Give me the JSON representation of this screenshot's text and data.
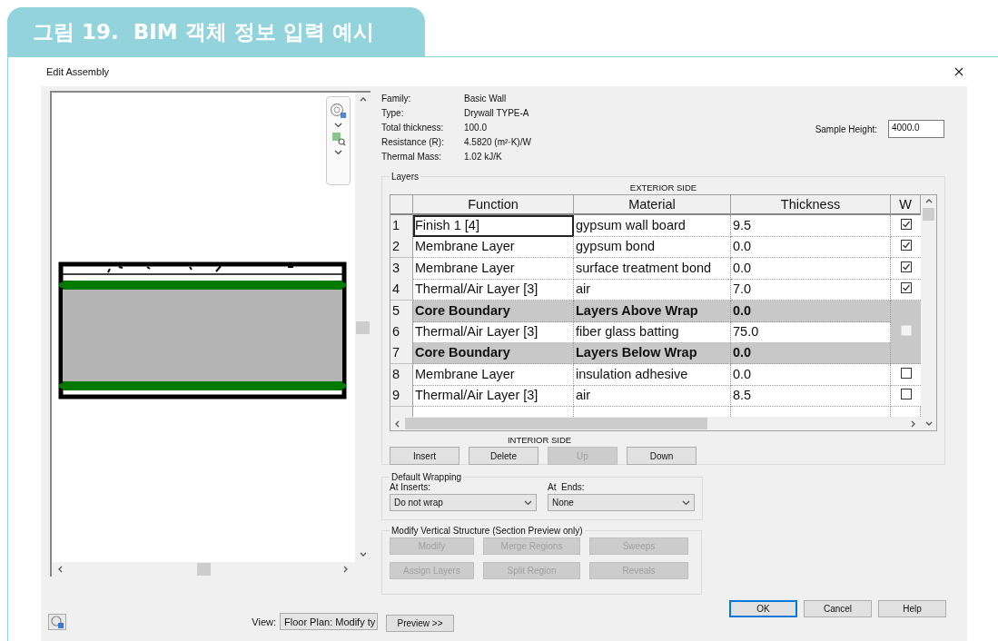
{
  "header": {
    "title": "그림 19.  BIM 객체 정보 입력 예시"
  },
  "dialog": {
    "title": "Edit Assembly"
  },
  "properties": [
    {
      "label": "Family:",
      "value": "Basic Wall"
    },
    {
      "label": "Type:",
      "value": "Drywall TYPE-A"
    },
    {
      "label": "Total thickness:",
      "value": "100.0"
    },
    {
      "label": "Resistance (R):",
      "value": "4.5820 (m²·K)/W"
    },
    {
      "label": "Thermal Mass:",
      "value": "1.02 kJ/K"
    }
  ],
  "sample_height": {
    "label": "Sample Height:",
    "value": "4000.0"
  },
  "layers": {
    "title": "Layers",
    "top_caption": "EXTERIOR SIDE",
    "bottom_caption": "INTERIOR SIDE",
    "columns": [
      "Function",
      "Material",
      "Thickness",
      "W"
    ],
    "rows": [
      {
        "num": "1",
        "kind": "layer",
        "function": "Finish 1 [4]",
        "material": "gypsum wall board",
        "thickness": "9.5",
        "wraps": true,
        "disabled": false,
        "selected": true
      },
      {
        "num": "2",
        "kind": "layer",
        "function": "Membrane Layer",
        "material": "gypsum bond",
        "thickness": "0.0",
        "wraps": true,
        "disabled": false,
        "selected": false
      },
      {
        "num": "3",
        "kind": "layer",
        "function": "Membrane Layer",
        "material": "surface treatment bond",
        "thickness": "0.0",
        "wraps": true,
        "disabled": false,
        "selected": false
      },
      {
        "num": "4",
        "kind": "layer",
        "function": "Thermal/Air Layer [3]",
        "material": "air",
        "thickness": "7.0",
        "wraps": true,
        "disabled": false,
        "selected": false
      },
      {
        "num": "5",
        "kind": "boundary",
        "function": "Core Boundary",
        "material": "Layers Above Wrap",
        "thickness": "0.0",
        "selected": false
      },
      {
        "num": "6",
        "kind": "layer",
        "function": "Thermal/Air Layer [3]",
        "material": "fiber glass batting",
        "thickness": "75.0",
        "wraps": false,
        "disabled": true,
        "selected": false
      },
      {
        "num": "7",
        "kind": "boundary",
        "function": "Core Boundary",
        "material": "Layers Below Wrap",
        "thickness": "0.0",
        "selected": false
      },
      {
        "num": "8",
        "kind": "layer",
        "function": "Membrane Layer",
        "material": "insulation adhesive",
        "thickness": "0.0",
        "wraps": false,
        "disabled": false,
        "selected": false
      },
      {
        "num": "9",
        "kind": "layer",
        "function": "Thermal/Air Layer [3]",
        "material": "air",
        "thickness": "8.5",
        "wraps": false,
        "disabled": false,
        "selected": false
      }
    ],
    "buttons": [
      {
        "label": "Insert",
        "disabled": false
      },
      {
        "label": "Delete",
        "disabled": false
      },
      {
        "label": "Up",
        "disabled": true
      },
      {
        "label": "Down",
        "disabled": false
      }
    ]
  },
  "default_wrapping": {
    "title": "Default Wrapping",
    "fields": [
      {
        "label": "At Inserts:",
        "value": "Do not wrap"
      },
      {
        "label": "At  Ends:",
        "value": "None"
      }
    ]
  },
  "vertical_structure": {
    "title": "Modify Vertical Structure (Section Preview only)",
    "buttons": [
      {
        "label": "Modify",
        "disabled": true
      },
      {
        "label": "Merge Regions",
        "disabled": true
      },
      {
        "label": "Sweeps",
        "disabled": true
      },
      {
        "label": "Assign Layers",
        "disabled": true
      },
      {
        "label": "Split Region",
        "disabled": true
      },
      {
        "label": "Reveals",
        "disabled": true
      }
    ]
  },
  "view": {
    "label": "View:",
    "value": "Floor Plan: Modify ty"
  },
  "preview_button": {
    "label": "Preview >>"
  },
  "actions": [
    {
      "label": "OK",
      "default": true
    },
    {
      "label": "Cancel",
      "default": false
    },
    {
      "label": "Help",
      "default": false
    }
  ]
}
